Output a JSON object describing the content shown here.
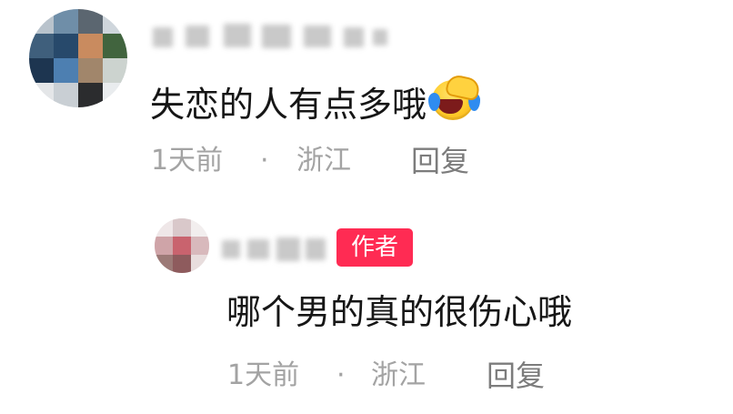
{
  "comment": {
    "author_name": "",
    "text": "失恋的人有点多哦",
    "emoji": "facepalm-crying-emoji",
    "time": "1天前",
    "separator": "·",
    "location": "浙江",
    "reply_label": "回复"
  },
  "reply": {
    "author_name": "",
    "badge": "作者",
    "text": "哪个男的真的很伤心哦",
    "time": "1天前",
    "separator": "·",
    "location": "浙江",
    "reply_label": "回复"
  },
  "colors": {
    "badge_bg": "#ff2b53",
    "text": "#161616",
    "meta": "#a3a3a3"
  }
}
